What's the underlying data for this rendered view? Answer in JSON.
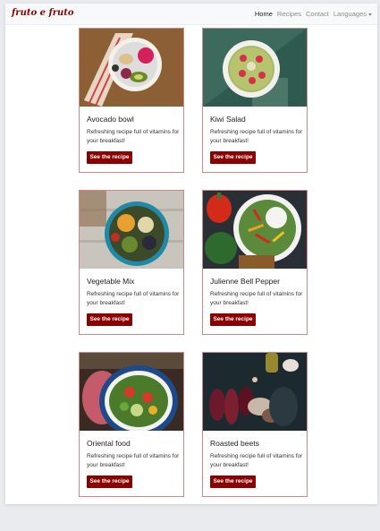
{
  "navbar": {
    "brand": "fruto e fruto",
    "links": [
      "Home",
      "Recipes",
      "Contact",
      "Languages"
    ],
    "active_link": "Home"
  },
  "cards": [
    {
      "title": "Avocado bowl",
      "text": "Refreshing recipe full of vitamins for your breakfast!",
      "button": "See the recipe",
      "image": "avocado-bowl-photo"
    },
    {
      "title": "Kiwi Salad",
      "text": "Refreshing recipe full of vitamins for your breakfast!",
      "button": "See the recipe",
      "image": "kiwi-salad-photo"
    },
    {
      "title": "Vegetable Mix",
      "text": "Refreshing recipe full of vitamins for your breakfast!",
      "button": "See the recipe",
      "image": "vegetable-mix-photo"
    },
    {
      "title": "Julienne Bell Pepper",
      "text": "Refreshing recipe full of vitamins for your breakfast!",
      "button": "See the recipe",
      "image": "bell-pepper-photo"
    },
    {
      "title": "Oriental food",
      "text": "Refreshing recipe full of vitamins for your breakfast!",
      "button": "See the recipe",
      "image": "oriental-food-photo"
    },
    {
      "title": "Roasted beets",
      "text": "Refreshing recipe full of vitamins for your breakfast!",
      "button": "See the recipe",
      "image": "roasted-beets-photo"
    }
  ],
  "colors": {
    "brand": "#8b0000",
    "card_border": "#c98a8a",
    "button_bg": "#8b0000",
    "navbar_bg": "#f8f9fa"
  }
}
